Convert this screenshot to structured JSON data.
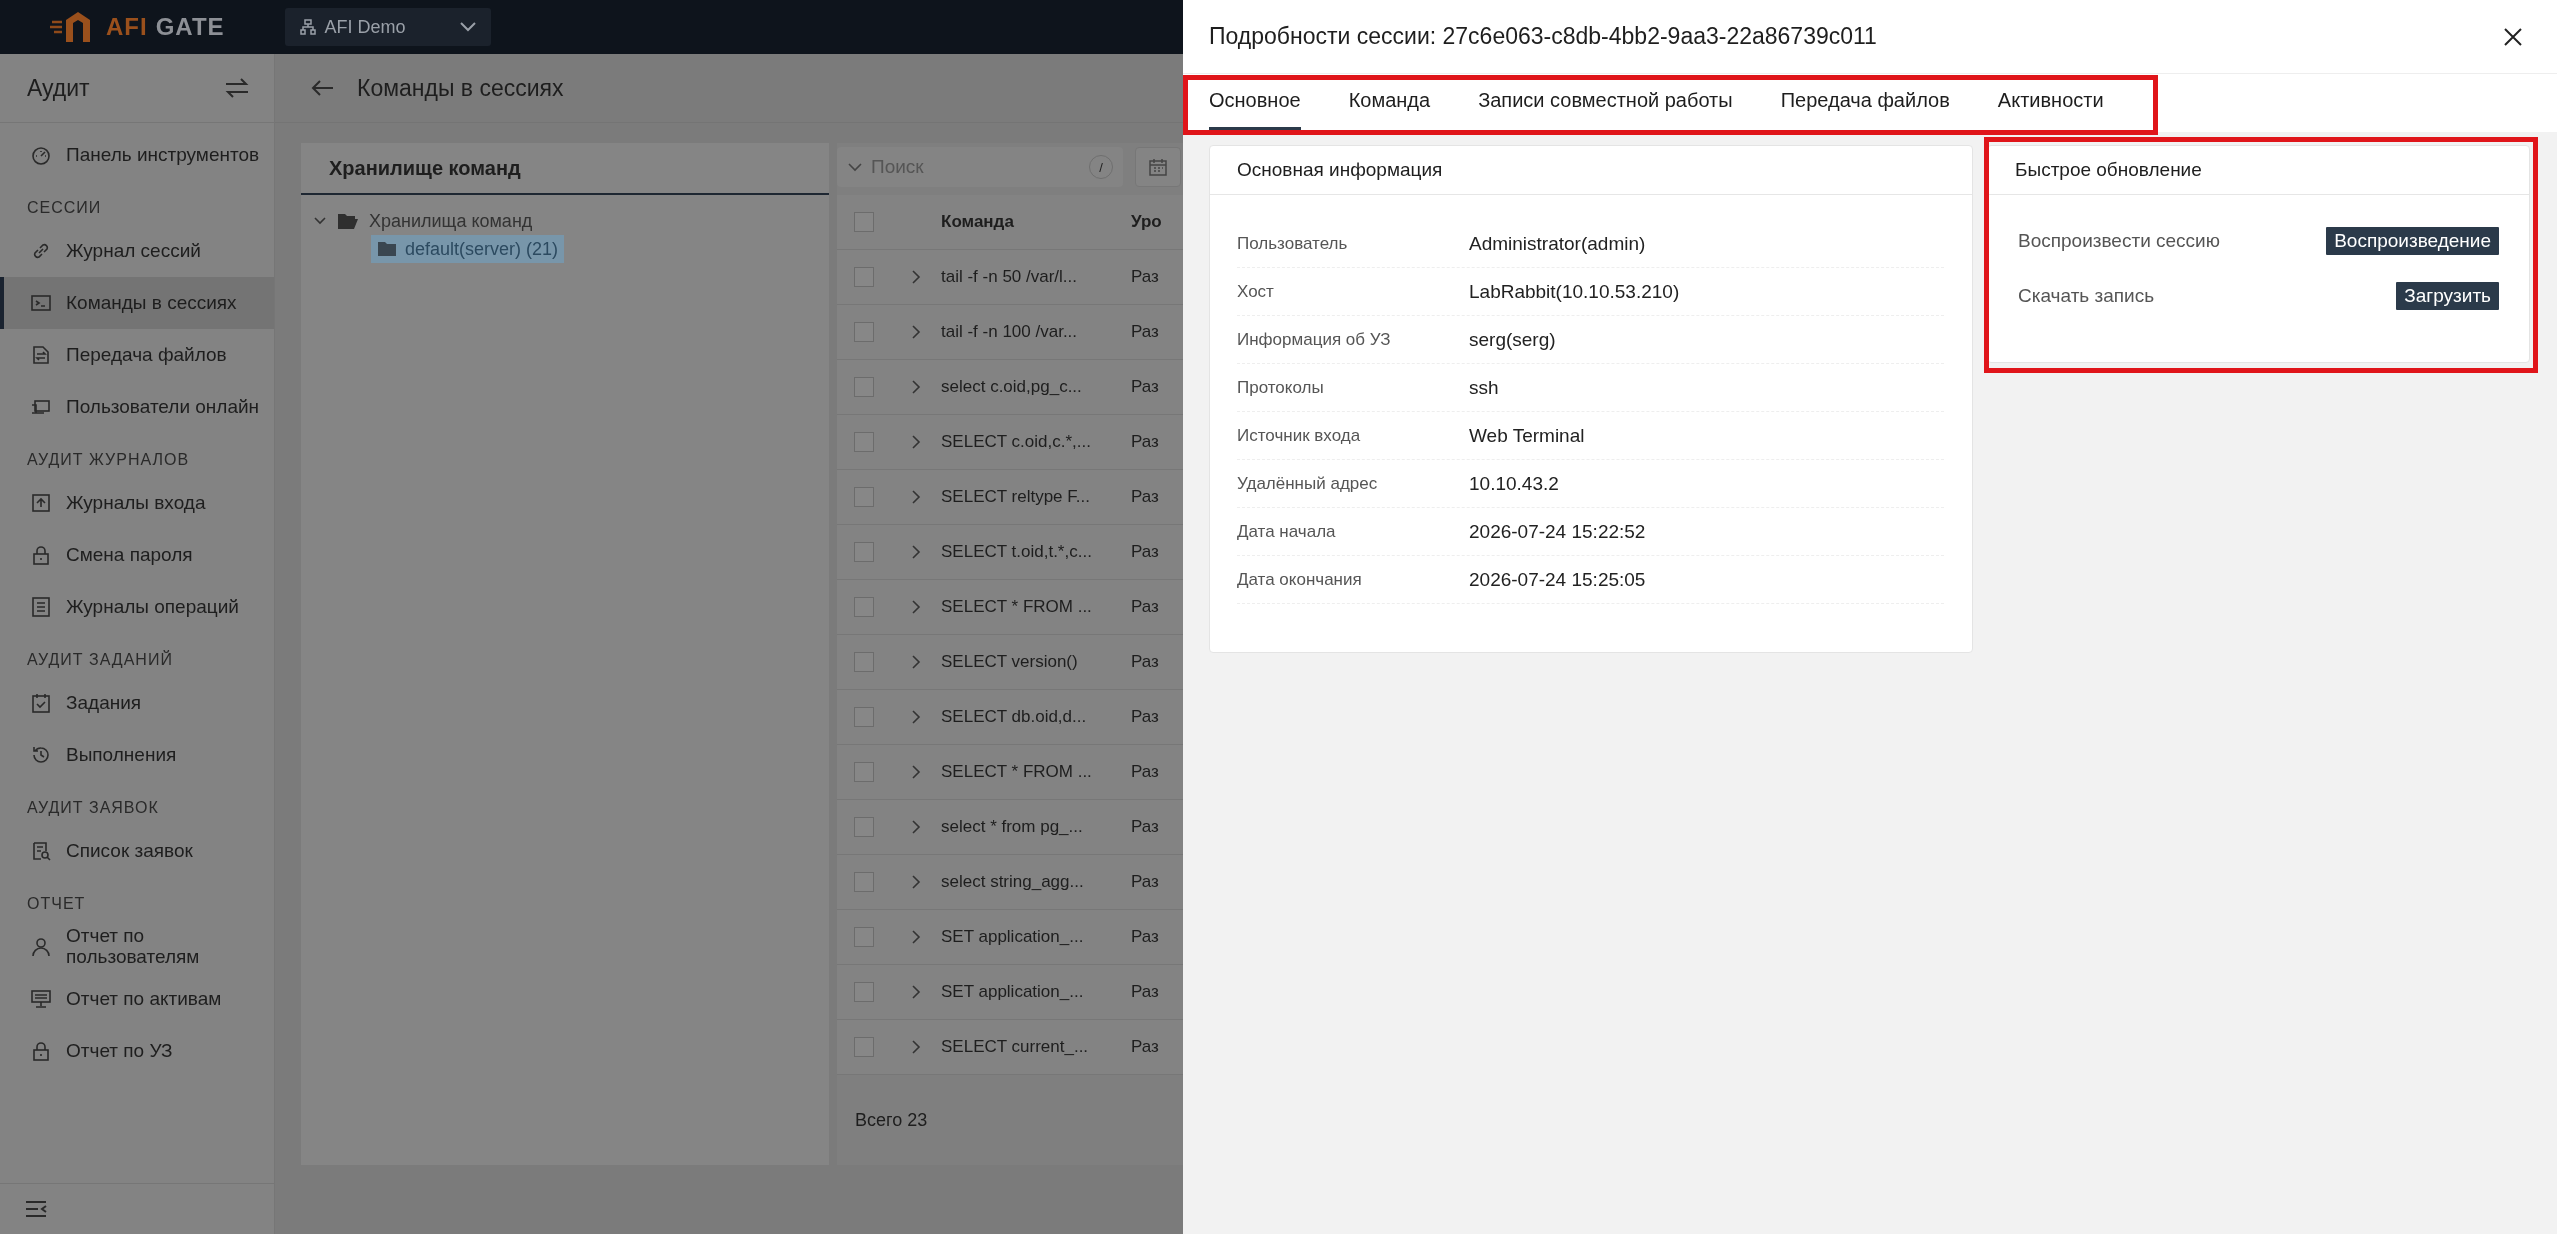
{
  "top_bar": {
    "logo_text": [
      "AFI",
      "GATE"
    ],
    "tenant": "AFI Demo"
  },
  "sidebar": {
    "title": "Аудит",
    "sections": [
      {
        "items": [
          {
            "label": "Панель инструментов",
            "selected": false
          }
        ]
      },
      {
        "heading": "СЕССИИ",
        "items": [
          {
            "label": "Журнал сессий",
            "selected": false
          },
          {
            "label": "Команды в сессиях",
            "selected": true
          },
          {
            "label": "Передача файлов",
            "selected": false
          },
          {
            "label": "Пользователи онлайн",
            "selected": false
          }
        ]
      },
      {
        "heading": "АУДИТ ЖУРНАЛОВ",
        "items": [
          {
            "label": "Журналы входа",
            "selected": false
          },
          {
            "label": "Смена пароля",
            "selected": false
          },
          {
            "label": "Журналы операций",
            "selected": false
          }
        ]
      },
      {
        "heading": "АУДИТ ЗАДАНИЙ",
        "items": [
          {
            "label": "Задания",
            "selected": false
          },
          {
            "label": "Выполнения",
            "selected": false
          }
        ]
      },
      {
        "heading": "АУДИТ ЗАЯВОК",
        "items": [
          {
            "label": "Список заявок",
            "selected": false
          }
        ]
      },
      {
        "heading": "ОТЧЕТ",
        "items": [
          {
            "label": "Отчет по пользователям",
            "selected": false
          },
          {
            "label": "Отчет по активам",
            "selected": false
          },
          {
            "label": "Отчет по УЗ",
            "selected": false
          }
        ]
      }
    ]
  },
  "page": {
    "title": "Команды в сессиях"
  },
  "tree": {
    "title": "Хранилище команд",
    "items": [
      {
        "label": "Хранилища команд",
        "expanded": true,
        "children": [
          {
            "label": "default(server) (21)",
            "selected": true
          }
        ]
      }
    ]
  },
  "table": {
    "search": {
      "placeholder": "Поиск",
      "shortcut": "/"
    },
    "header_checked": false,
    "columns": [
      "Команда",
      "Уро"
    ],
    "rows": [
      {
        "checked": false,
        "expanded": false,
        "command": "tail -f -n 50 /var/l...",
        "column_3": "Раз"
      },
      {
        "checked": false,
        "expanded": false,
        "command": "tail -f -n 100 /var...",
        "column_3": "Раз"
      },
      {
        "checked": false,
        "expanded": false,
        "command": "select c.oid,pg_c...",
        "column_3": "Раз"
      },
      {
        "checked": false,
        "expanded": false,
        "command": "SELECT c.oid,c.*,...",
        "column_3": "Раз"
      },
      {
        "checked": false,
        "expanded": false,
        "command": "SELECT reltype F...",
        "column_3": "Раз"
      },
      {
        "checked": false,
        "expanded": false,
        "command": "SELECT t.oid,t.*,c...",
        "column_3": "Раз"
      },
      {
        "checked": false,
        "expanded": false,
        "command": "SELECT * FROM ...",
        "column_3": "Раз"
      },
      {
        "checked": false,
        "expanded": false,
        "command": "SELECT version()",
        "column_3": "Раз"
      },
      {
        "checked": false,
        "expanded": false,
        "command": "SELECT db.oid,d...",
        "column_3": "Раз"
      },
      {
        "checked": false,
        "expanded": false,
        "command": "SELECT * FROM ...",
        "column_3": "Раз"
      },
      {
        "checked": false,
        "expanded": false,
        "command": "select * from pg_...",
        "column_3": "Раз"
      },
      {
        "checked": false,
        "expanded": false,
        "command": "select string_agg...",
        "column_3": "Раз"
      },
      {
        "checked": false,
        "expanded": false,
        "command": "SET application_...",
        "column_3": "Раз"
      },
      {
        "checked": false,
        "expanded": false,
        "command": "SET application_...",
        "column_3": "Раз"
      },
      {
        "checked": false,
        "expanded": false,
        "command": "SELECT current_...",
        "column_3": "Раз"
      }
    ],
    "footer": "Всего 23"
  },
  "drawer": {
    "title": "Подробности сессии: 27c6e063-c8db-4bb2-9aa3-22a86739c011",
    "tabs": [
      {
        "label": "Основное",
        "selected": true
      },
      {
        "label": "Команда",
        "selected": false
      },
      {
        "label": "Записи совместной работы",
        "selected": false
      },
      {
        "label": "Передача файлов",
        "selected": false
      },
      {
        "label": "Активности",
        "selected": false
      }
    ],
    "basic_info": {
      "title": "Основная информация",
      "fields": [
        {
          "label": "Пользователь",
          "value": "Administrator(admin)"
        },
        {
          "label": "Хост",
          "value": "LabRabbit(10.10.53.210)"
        },
        {
          "label": "Информация об УЗ",
          "value": "serg(serg)"
        },
        {
          "label": "Протоколы",
          "value": "ssh"
        },
        {
          "label": "Источник входа",
          "value": "Web Terminal"
        },
        {
          "label": "Удалённый адрес",
          "value": "10.10.43.2"
        },
        {
          "label": "Дата начала",
          "value": "2026-07-24 15:22:52"
        },
        {
          "label": "Дата окончания",
          "value": "2026-07-24 15:25:05"
        }
      ]
    },
    "quick_actions": {
      "title": "Быстрое обновление",
      "rows": [
        {
          "label": "Воспроизвести сессию",
          "button": "Воспроизведение"
        },
        {
          "label": "Скачать запись",
          "button": "Загрузить"
        }
      ]
    }
  }
}
